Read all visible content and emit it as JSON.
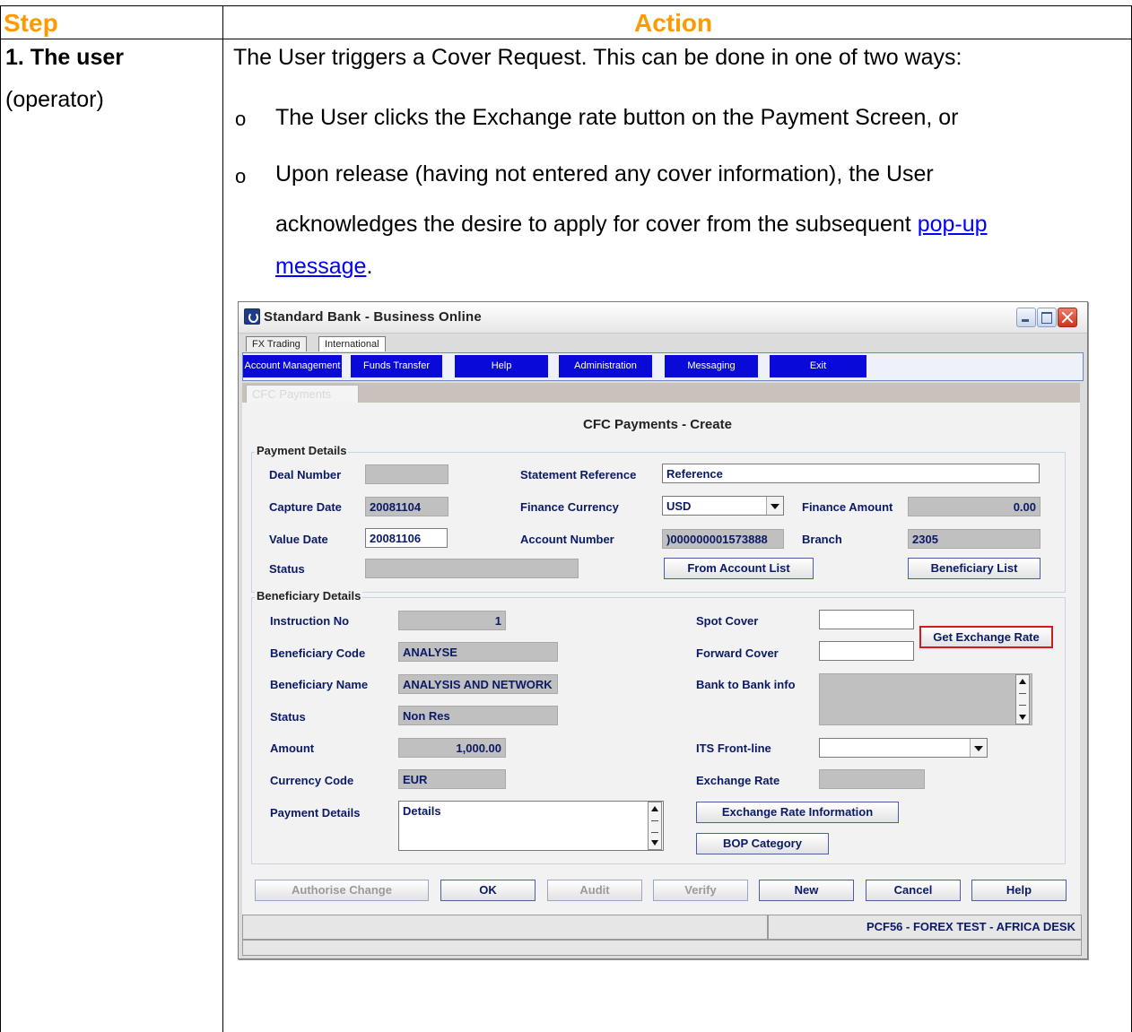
{
  "table": {
    "headers": {
      "step": "Step",
      "action": "Action"
    },
    "step": {
      "title": "1. The user",
      "subtitle": "(operator)"
    },
    "intro": "The User triggers a Cover Request.  This can be done in one of two ways:",
    "bullet_marker": "o",
    "bullet1": "The User clicks the Exchange rate  button on the Payment Screen, or",
    "bullet2_line1": "Upon release (having not entered any cover information), the User",
    "bullet2_line2_text": "acknowledges the desire to apply for cover from the subsequent ",
    "bullet2_link_part1": "pop-up",
    "bullet2_link_part2": "message",
    "bullet2_end": "."
  },
  "window": {
    "title": "Standard Bank - Business Online",
    "tabs": [
      "FX Trading",
      "International"
    ],
    "menu": [
      "Account Management",
      "Funds Transfer",
      "Help",
      "Administration",
      "Messaging",
      "Exit"
    ],
    "subtab": "CFC Payments",
    "form_title": "CFC Payments - Create",
    "payment_details": {
      "group_title": "Payment Details",
      "deal_number_label": "Deal Number",
      "deal_number": "",
      "statement_reference_label": "Statement Reference",
      "statement_reference": "Reference",
      "capture_date_label": "Capture Date",
      "capture_date": "20081104",
      "finance_currency_label": "Finance Currency",
      "finance_currency": "USD",
      "finance_amount_label": "Finance Amount",
      "finance_amount": "0.00",
      "value_date_label": "Value Date",
      "value_date": "20081106",
      "account_number_label": "Account Number",
      "account_number": ")000000001573888",
      "branch_label": "Branch",
      "branch": "2305",
      "status_label": "Status",
      "status": "",
      "from_account_list": "From Account List",
      "beneficiary_list": "Beneficiary List"
    },
    "beneficiary_details": {
      "group_title": "Beneficiary Details",
      "instruction_no_label": "Instruction No",
      "instruction_no": "1",
      "beneficiary_code_label": "Beneficiary Code",
      "beneficiary_code": "ANALYSE",
      "beneficiary_name_label": "Beneficiary Name",
      "beneficiary_name": "ANALYSIS AND NETWORK",
      "status_label": "Status",
      "status": "Non Res",
      "amount_label": "Amount",
      "amount": "1,000.00",
      "currency_code_label": "Currency Code",
      "currency_code": "EUR",
      "payment_details_label": "Payment Details",
      "payment_details": "Details",
      "spot_cover_label": "Spot Cover",
      "spot_cover": "",
      "forward_cover_label": "Forward Cover",
      "forward_cover": "",
      "get_exchange_rate": "Get Exchange Rate",
      "bank_to_bank_label": "Bank to Bank info",
      "bank_to_bank": "",
      "its_frontline_label": "ITS Front-line",
      "its_frontline": "",
      "exchange_rate_label": "Exchange Rate",
      "exchange_rate": "",
      "exchange_rate_information": "Exchange Rate Information",
      "bop_category": "BOP Category"
    },
    "buttons": {
      "authorise_change": "Authorise Change",
      "ok": "OK",
      "audit": "Audit",
      "verify": "Verify",
      "new": "New",
      "cancel": "Cancel",
      "help": "Help"
    },
    "status_bar": {
      "left": "",
      "right": "PCF56 - FOREX TEST - AFRICA DESK"
    },
    "colors": {
      "menu_blue": "#0a0ad8",
      "label_navy": "#0b1a66",
      "header_orange": "#ff9900",
      "highlight_red": "#d41a1a"
    }
  }
}
